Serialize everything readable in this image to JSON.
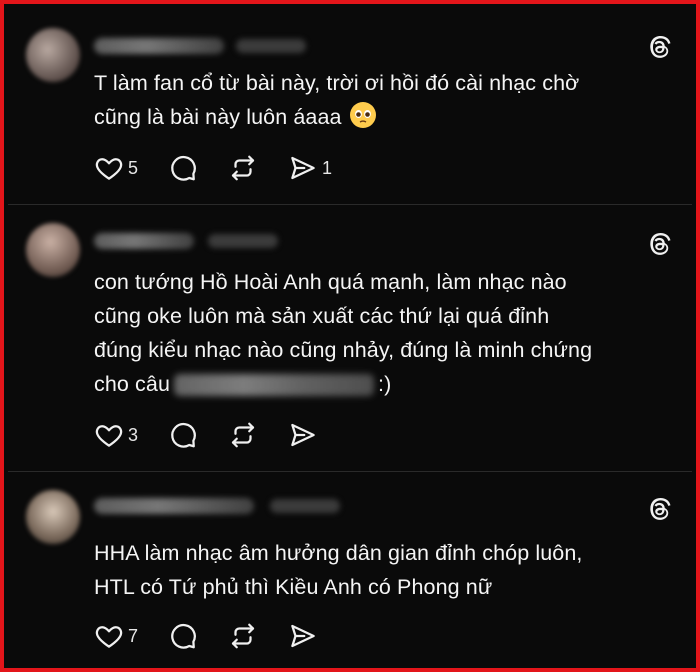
{
  "colors": {
    "frame_border": "#e3151a",
    "background": "#0a0a0a",
    "text": "#f5f5f5"
  },
  "posts": [
    {
      "text_lines": [
        "T làm fan cổ từ bài này, trời ơi hồi đó cài nhạc chờ",
        "cũng là bài này luôn áaaa"
      ],
      "emoji": "pleading-face",
      "likes": "5",
      "shares": "1"
    },
    {
      "text_lines": [
        "con tướng Hồ Hoài Anh quá mạnh, làm nhạc nào",
        "cũng oke luôn mà sản xuất các thứ lại quá đỉnh",
        "đúng kiểu nhạc nào cũng nhảy, đúng là minh chứng"
      ],
      "last_line_prefix": "cho câu",
      "last_line_suffix": ":)",
      "likes": "3",
      "shares": ""
    },
    {
      "text_lines": [
        "HHA làm nhạc âm hưởng dân gian đỉnh chóp luôn,",
        "HTL có Tứ phủ thì Kiều Anh có Phong nữ"
      ],
      "likes": "7",
      "shares": ""
    }
  ],
  "icons": [
    "heart-icon",
    "comment-icon",
    "repost-icon",
    "share-icon",
    "threads-logo-icon"
  ]
}
